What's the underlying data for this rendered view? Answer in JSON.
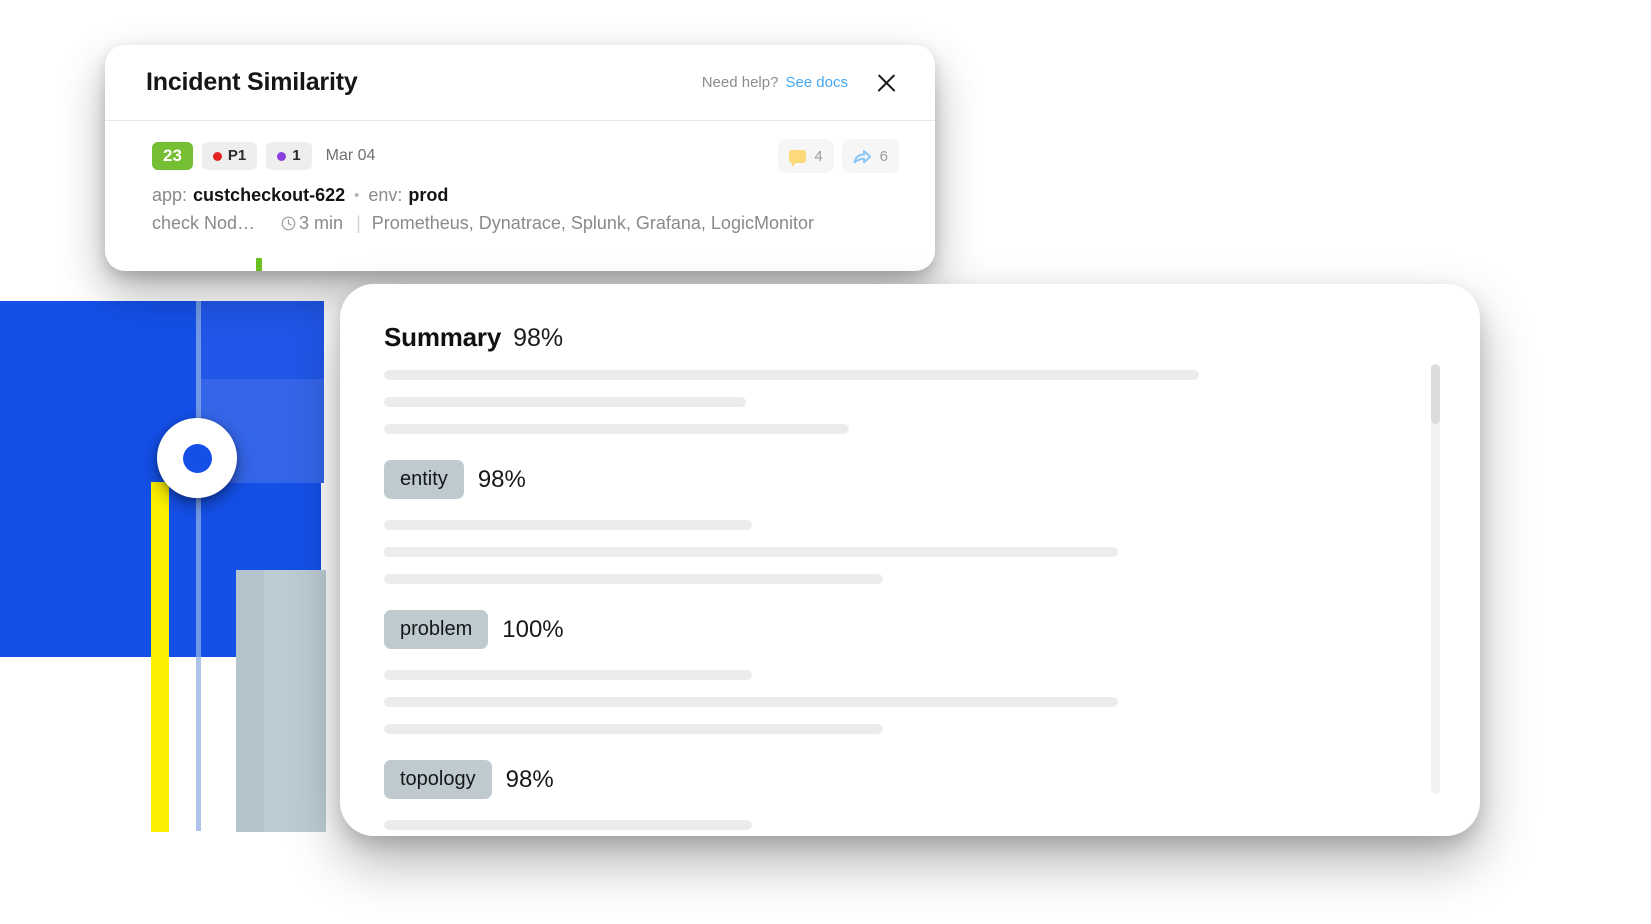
{
  "incident_card": {
    "title": "Incident Similarity",
    "need_help_label": "Need help?",
    "see_docs_label": "See docs",
    "close_icon": "close-icon",
    "incident": {
      "count_badge": "23",
      "severity": "P1",
      "severity_dot_color": "#e62323",
      "secondary_count": "1",
      "secondary_dot_color": "#8b3fe0",
      "date": "Mar 04",
      "comment_icon": "comment-bubble-icon",
      "comment_count": "4",
      "share_icon": "share-arrow-icon",
      "share_count": "6",
      "app_label": "app:",
      "app_value": "custcheckout-622",
      "separator": "•",
      "env_label": "env:",
      "env_value": "prod",
      "check_name": "check Nod…",
      "clock_icon": "clock-icon",
      "duration": "3 min",
      "pipe": "|",
      "tools": "Prometheus, Dynatrace, Splunk, Grafana, LogicMonitor",
      "accent_color": "#6bc020"
    }
  },
  "summary_panel": {
    "title": "Summary",
    "percent": "98%",
    "sections": [
      {
        "tag": "entity",
        "percent": "98%"
      },
      {
        "tag": "problem",
        "percent": "100%"
      },
      {
        "tag": "topology",
        "percent": "98%"
      }
    ]
  }
}
